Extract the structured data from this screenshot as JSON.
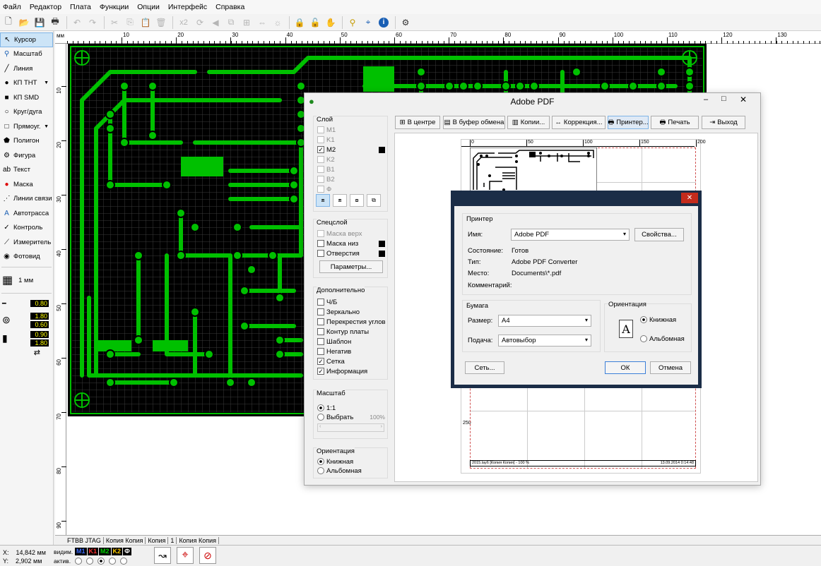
{
  "menu": [
    "Файл",
    "Редактор",
    "Плата",
    "Функции",
    "Опции",
    "Интерфейс",
    "Справка"
  ],
  "toolbar": {
    "zoom_label": "x2"
  },
  "tools": [
    {
      "label": "Курсор",
      "icon": "cursor-icon",
      "glyph": "↖",
      "color": "#000"
    },
    {
      "label": "Масштаб",
      "icon": "zoom-icon",
      "glyph": "⚲",
      "color": "#1a5fb4"
    },
    {
      "label": "Линия",
      "icon": "line-icon",
      "glyph": "╱",
      "color": "#000"
    },
    {
      "label": "КП ТНТ",
      "icon": "pad-tht-icon",
      "glyph": "●",
      "color": "#000"
    },
    {
      "label": "КП SMD",
      "icon": "pad-smd-icon",
      "glyph": "■",
      "color": "#000"
    },
    {
      "label": "Круг/дуга",
      "icon": "circle-icon",
      "glyph": "○",
      "color": "#000"
    },
    {
      "label": "Прямоуг.",
      "icon": "rectangle-icon",
      "glyph": "□",
      "color": "#000"
    },
    {
      "label": "Полигон",
      "icon": "polygon-icon",
      "glyph": "⬟",
      "color": "#000"
    },
    {
      "label": "Фигура",
      "icon": "shape-icon",
      "glyph": "⚙",
      "color": "#000"
    },
    {
      "label": "Текст",
      "icon": "text-icon",
      "glyph": "ab",
      "color": "#000"
    },
    {
      "label": "Маска",
      "icon": "mask-icon",
      "glyph": "●",
      "color": "#d00"
    },
    {
      "label": "Линии связи",
      "icon": "connections-icon",
      "glyph": "⋰",
      "color": "#000"
    },
    {
      "label": "Автотрасса",
      "icon": "autoroute-icon",
      "glyph": "A",
      "color": "#1a5fb4"
    },
    {
      "label": "Контроль",
      "icon": "check-icon",
      "glyph": "✓",
      "color": "#000"
    },
    {
      "label": "Измеритель",
      "icon": "ruler-icon",
      "glyph": "⟋",
      "color": "#000"
    },
    {
      "label": "Фотовид",
      "icon": "photo-icon",
      "glyph": "◉",
      "color": "#000"
    }
  ],
  "grid": {
    "label": "1 мм"
  },
  "params": {
    "track": "0.80",
    "pad_outer": "1.80",
    "pad_inner": "0.60",
    "smd_w": "0.90",
    "smd_h": "1.80"
  },
  "ruler": {
    "unit": "мм",
    "ticks": [
      "10",
      "20",
      "30",
      "40",
      "50",
      "60",
      "70",
      "80",
      "90",
      "100",
      "110",
      "120",
      "130"
    ],
    "vticks": [
      "10",
      "20",
      "30",
      "40",
      "50",
      "60",
      "70",
      "80",
      "90"
    ]
  },
  "tabs": [
    "FTBB JTAG",
    "Копия Копия",
    "Копия",
    "1",
    "Копия Копия"
  ],
  "status": {
    "x_label": "X:",
    "x_value": "14,842 мм",
    "y_label": "Y:",
    "y_value": "2,902 мм",
    "visible_label": "видим.",
    "active_label": "актив."
  },
  "layers": [
    {
      "name": "M1",
      "color": "#3c6cff"
    },
    {
      "name": "K1",
      "color": "#ff3030"
    },
    {
      "name": "M2",
      "color": "#00d000"
    },
    {
      "name": "K2",
      "color": "#ffcc00"
    },
    {
      "name": "Ф",
      "color": "#ffffff"
    }
  ],
  "pdf": {
    "title": "Adobe PDF",
    "layer_group": "Слой",
    "layers": [
      {
        "name": "M1",
        "checked": false,
        "enabled": false
      },
      {
        "name": "K1",
        "checked": false,
        "enabled": false
      },
      {
        "name": "M2",
        "checked": true,
        "enabled": true
      },
      {
        "name": "K2",
        "checked": false,
        "enabled": false
      },
      {
        "name": "B1",
        "checked": false,
        "enabled": false
      },
      {
        "name": "B2",
        "checked": false,
        "enabled": false
      },
      {
        "name": "Ф",
        "checked": false,
        "enabled": false
      }
    ],
    "special_group": "Спецслой",
    "special": [
      {
        "name": "Маска верх",
        "checked": false,
        "enabled": false
      },
      {
        "name": "Маска низ",
        "checked": false,
        "enabled": true
      },
      {
        "name": "Отверстия",
        "checked": false,
        "enabled": true
      }
    ],
    "params_button": "Параметры...",
    "extra_group": "Дополнительно",
    "extra": [
      {
        "name": "Ч/Б",
        "checked": false
      },
      {
        "name": "Зеркально",
        "checked": false
      },
      {
        "name": "Перекрестия углов",
        "checked": false
      },
      {
        "name": "Контур платы",
        "checked": false
      },
      {
        "name": "Шаблон",
        "checked": false
      },
      {
        "name": "Негатив",
        "checked": false
      },
      {
        "name": "Сетка",
        "checked": true
      },
      {
        "name": "Информация",
        "checked": true
      }
    ],
    "scale_group": "Масштаб",
    "scale_1": "1:1",
    "scale_choose": "Выбрать",
    "scale_pct": "100%",
    "orient_group": "Ориентация",
    "orient_portrait": "Книжная",
    "orient_landscape": "Альбомная",
    "toolbar": [
      "В центре",
      "В буфер обмена",
      "Копии...",
      "Коррекция...",
      "Принтер...",
      "Печать",
      "Выход"
    ],
    "preview_ruler": [
      "0",
      "50",
      "100",
      "150",
      "200"
    ],
    "preview_vruler": [
      "250"
    ],
    "footer_left": "2015.lay6 [Копия Копия] - 100 %",
    "footer_right": "13.09.2014 0:14:48"
  },
  "print": {
    "printer_group": "Принтер",
    "name_label": "Имя:",
    "name_value": "Adobe PDF",
    "props_button": "Свойства...",
    "state_label": "Состояние:",
    "state_value": "Готов",
    "type_label": "Тип:",
    "type_value": "Adobe PDF Converter",
    "place_label": "Место:",
    "place_value": "Documents\\*.pdf",
    "comment_label": "Комментарий:",
    "paper_group": "Бумага",
    "size_label": "Размер:",
    "size_value": "A4",
    "feed_label": "Подача:",
    "feed_value": "Автовыбор",
    "orient_group": "Ориентация",
    "portrait": "Книжная",
    "landscape": "Альбомная",
    "network_button": "Сеть...",
    "ok_button": "ОК",
    "cancel_button": "Отмена"
  }
}
